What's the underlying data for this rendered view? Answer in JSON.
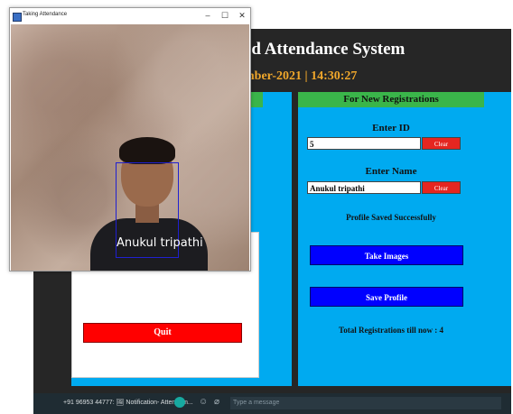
{
  "main_app": {
    "title": "ed Attendance System",
    "date_time": "mber-2021  |  14:30:27",
    "left": {
      "quit_label": "Quit"
    },
    "right": {
      "header": "For New Registrations",
      "enter_id_label": "Enter ID",
      "id_value": "5",
      "clear_label": "Clear",
      "enter_name_label": "Enter Name",
      "name_value": "Anukul tripathi",
      "status": "Profile Saved Successfully",
      "take_images_label": "Take Images",
      "save_profile_label": "Save Profile",
      "total_registrations": "Total Registrations till now  : 4"
    }
  },
  "camera_window": {
    "title": "Taking Attendance",
    "minimize": "–",
    "maximize": "☐",
    "close": "✕",
    "detected_name": "Anukul tripathi"
  },
  "chat_bar": {
    "notification": "+91 96953 44777: 🖼 Notification- Attendam...",
    "emoji": "☺",
    "attach": "⌀",
    "message_placeholder": "Type a message"
  },
  "colors": {
    "panel": "#00aaf0",
    "header_green": "#3ab54a",
    "title_gold": "#f0a72b",
    "quit_red": "#ff0000",
    "button_blue": "#0000ff",
    "face_box": "#2020d0"
  }
}
